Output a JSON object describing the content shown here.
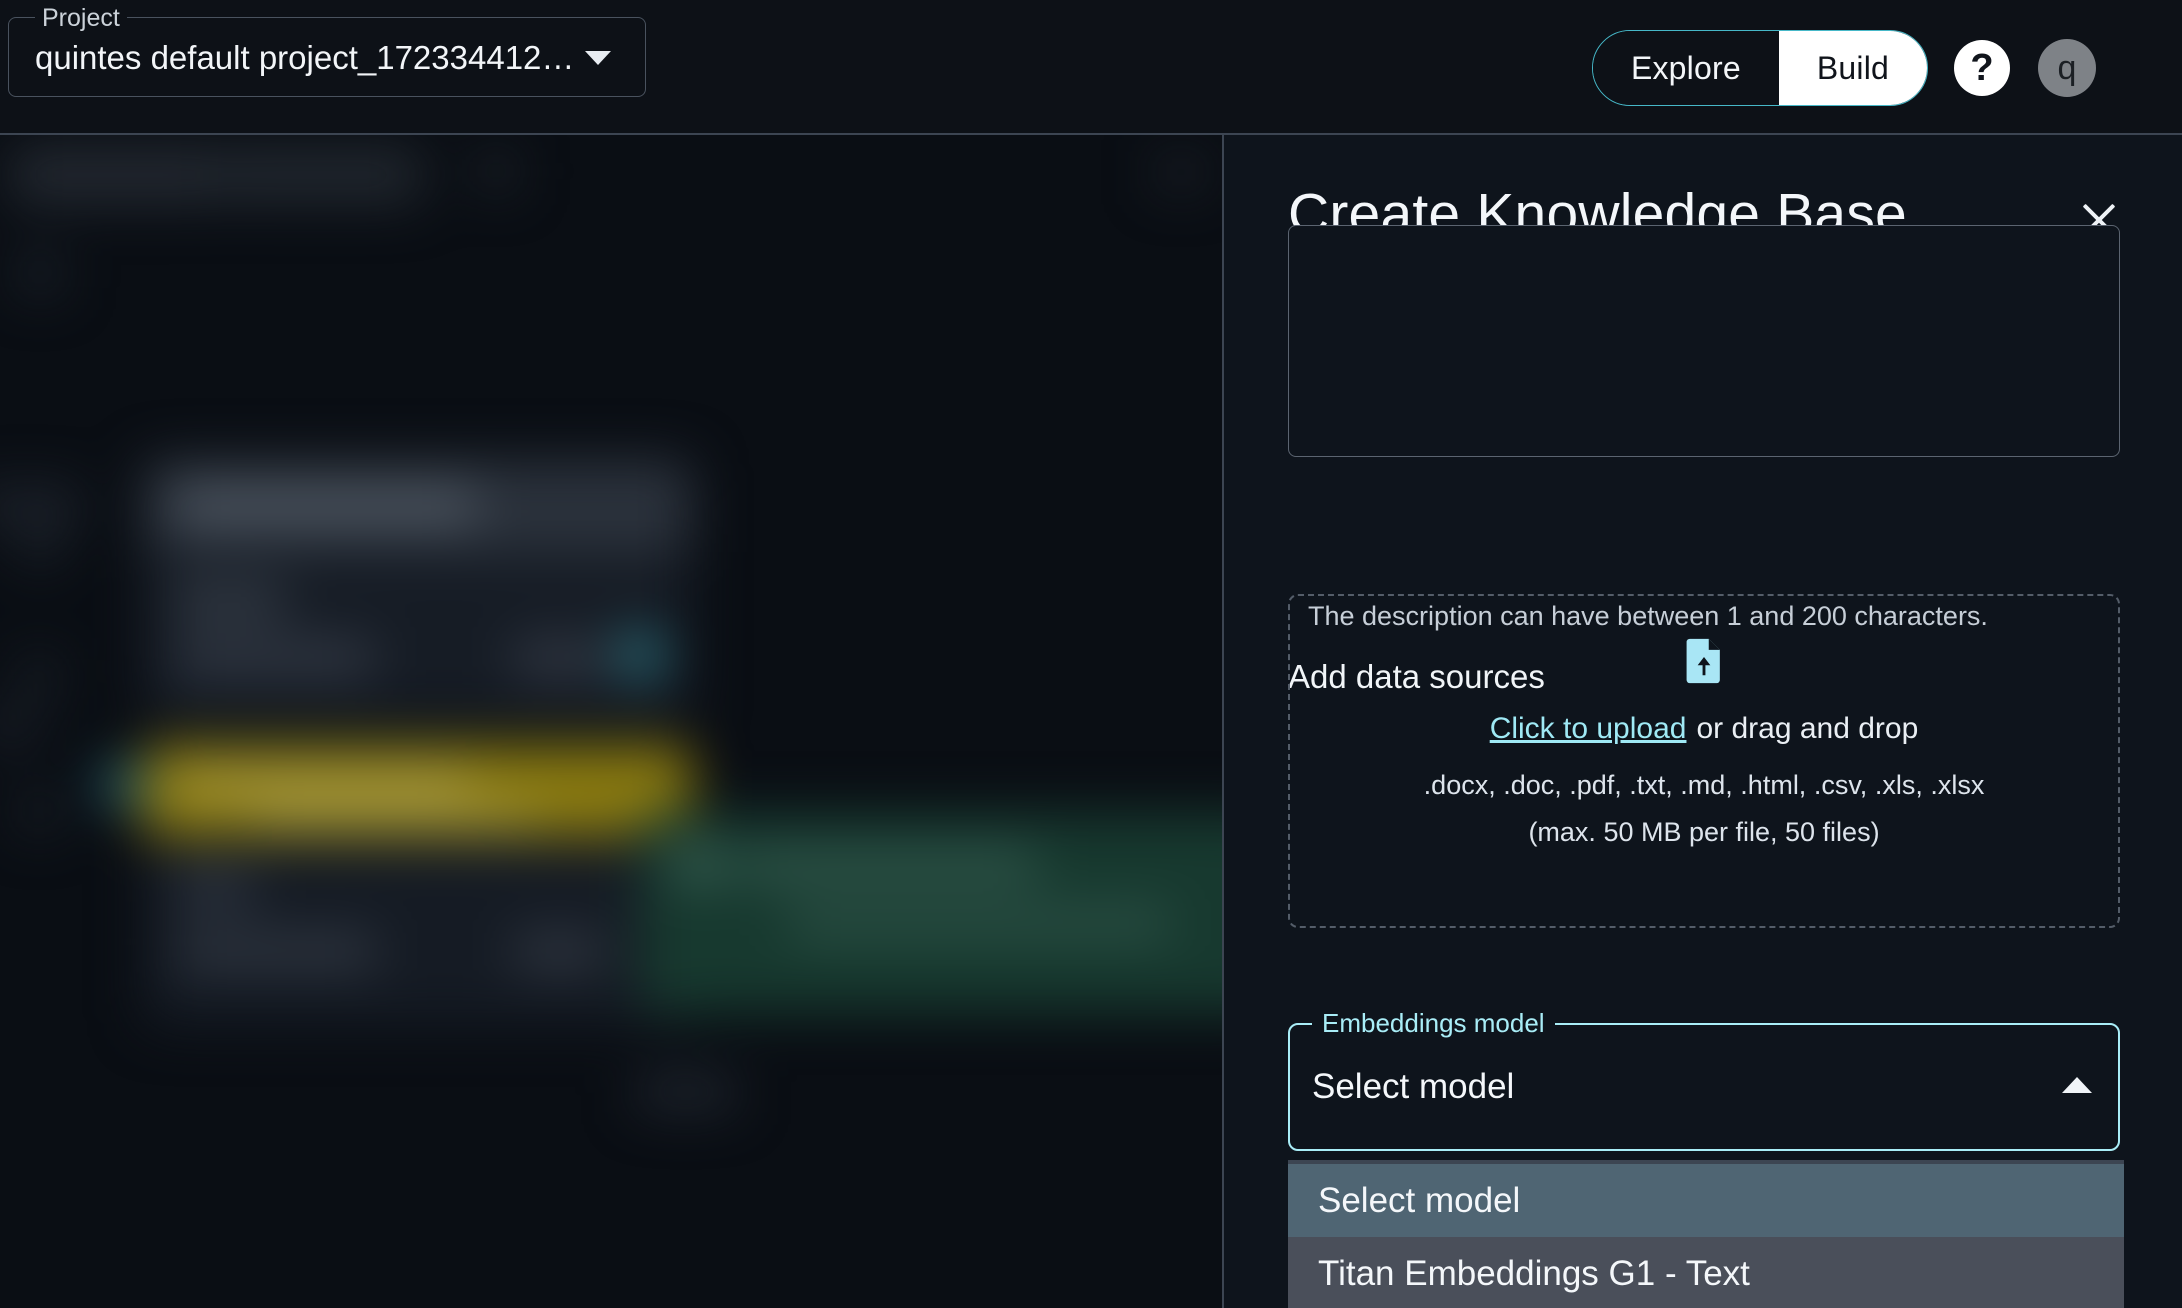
{
  "topbar": {
    "project_label": "Project",
    "project_value": "quintes default project_172334412…",
    "caret_icon": "chevron-down-icon",
    "segmented": [
      {
        "label": "Explore",
        "active": false
      },
      {
        "label": "Build",
        "active": true
      }
    ],
    "help_label": "?",
    "avatar_initial": "q"
  },
  "panel": {
    "title": "Create Knowledge Base",
    "close_icon": "close-icon",
    "description": {
      "value": "",
      "helper_text": "The description can have between 1 and 200 characters."
    },
    "data_sources": {
      "section_title": "Add data sources",
      "upload_icon": "file-upload-icon",
      "link_text": "Click to upload",
      "drag_text": "or drag and drop",
      "formats": ".docx, .doc, .pdf, .txt, .md, .html, .csv, .xls, .xlsx",
      "limits": "(max. 50 MB per file, 50 files)"
    },
    "embeddings": {
      "label": "Embeddings model",
      "selected": "Select model",
      "caret_icon": "chevron-up-icon",
      "options": [
        {
          "label": "Select model",
          "selected": true
        },
        {
          "label": "Titan Embeddings G1 - Text",
          "selected": false
        }
      ]
    }
  },
  "colors": {
    "accent_cyan": "#a9edf7",
    "link_cyan": "#9fe9f5",
    "panel_bg": "#0e141c",
    "page_bg": "#0d1117",
    "option_highlight": "#4f6573",
    "option_bg": "#4a4f5a"
  }
}
